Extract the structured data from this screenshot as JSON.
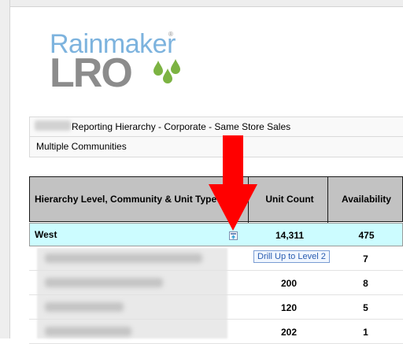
{
  "brand": {
    "name_top": "Rainmaker",
    "name_bottom": "LRO",
    "registered": "®",
    "colors": {
      "top": "#7db3de",
      "bottom": "#8c8c8c",
      "drops": "#7cb342"
    }
  },
  "report": {
    "hierarchy_label": "Reporting Hierarchy - Corporate - Same Store Sales",
    "communities_label": "Multiple Communities"
  },
  "table": {
    "headers": {
      "level": "Hierarchy Level, Community & Unit Type",
      "unit_count": "Unit Count",
      "availability": "Availability"
    },
    "region": {
      "name": "West",
      "unit_count": "14,311",
      "availability": "475"
    },
    "rows": [
      {
        "unit_count": "",
        "availability": "7"
      },
      {
        "unit_count": "200",
        "availability": "8"
      },
      {
        "unit_count": "120",
        "availability": "5"
      },
      {
        "unit_count": "202",
        "availability": "1"
      }
    ],
    "drill_tooltip": "Drill Up to Level 2"
  },
  "icons": {
    "drill": "drill-up-icon",
    "annotation": "red-arrow-icon"
  },
  "colors": {
    "header_bg": "#c2c2c2",
    "region_bg": "#ccfcff",
    "arrow": "#ff0000"
  }
}
